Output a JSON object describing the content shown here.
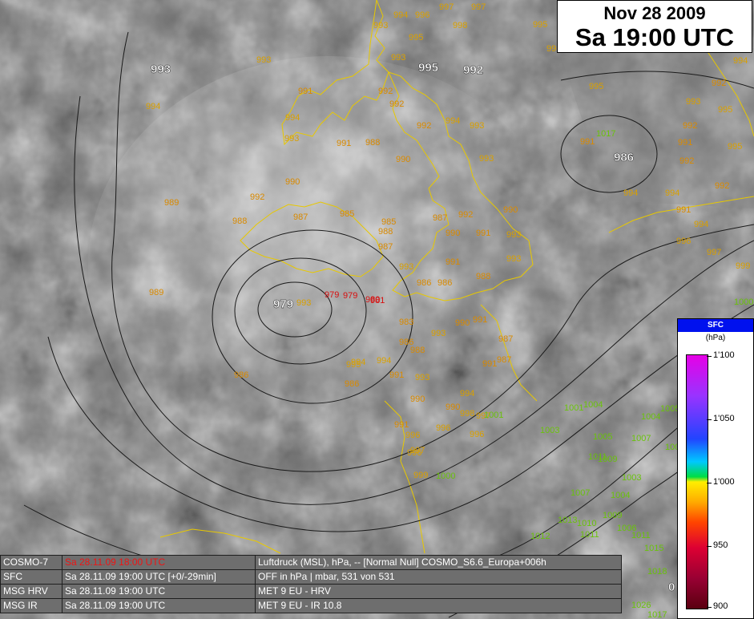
{
  "header": {
    "date": "Nov 28 2009",
    "time": "Sa 19:00 UTC"
  },
  "centers": [
    {
      "label": "993"
    },
    {
      "label": "995"
    },
    {
      "label": "992"
    },
    {
      "label": "986"
    },
    {
      "label": "979"
    },
    {
      "label": "0"
    }
  ],
  "observations": [
    "994",
    "996",
    "997",
    "997",
    "995",
    "998",
    "993",
    "993",
    "993",
    "994",
    "995",
    "993",
    "995",
    "993",
    "992",
    "991",
    "992",
    "994",
    "992",
    "991",
    "994",
    "993",
    "992",
    "992",
    "994",
    "993",
    "993",
    "991",
    "988",
    "990",
    "990",
    "992",
    "989",
    "988",
    "987",
    "985",
    "985",
    "988",
    "987",
    "987",
    "990",
    "991",
    "992",
    "990",
    "993",
    "993",
    "993",
    "986",
    "986",
    "988",
    "991",
    "993",
    "979",
    "979",
    "980",
    "981",
    "983",
    "986",
    "988",
    "993",
    "990",
    "991",
    "994",
    "995",
    "994",
    "991",
    "993",
    "991",
    "987",
    "987",
    "986",
    "986",
    "989",
    "990",
    "990",
    "991",
    "994",
    "996",
    "997",
    "996",
    "998",
    "996",
    "997",
    "996",
    "999",
    "1000",
    "1001",
    "1003",
    "1001",
    "1004",
    "1005",
    "1007",
    "1004",
    "1005",
    "1006",
    "1008",
    "1009",
    "1011",
    "1003",
    "1004",
    "1006",
    "1007",
    "1009",
    "1011",
    "1012",
    "1013",
    "1010",
    "1011",
    "1015",
    "1018",
    "1026",
    "1017",
    "1017",
    "994",
    "995",
    "995",
    "992",
    "991",
    "994",
    "992",
    "991",
    "994",
    "996",
    "997",
    "999",
    "1000",
    "1001",
    "998",
    "997",
    "995"
  ],
  "legend": {
    "title": "SFC",
    "unit": "(hPa)",
    "labels": [
      "1'100",
      "1'050",
      "1'000",
      "950",
      "900"
    ]
  },
  "info": [
    {
      "name": "COSMO-7",
      "time": "Sa 28.11.09 18:00 UTC",
      "desc": "Luftdruck (MSL), hPa, -- [Normal Null] COSMO_S6.6_Europa+006h"
    },
    {
      "name": "SFC",
      "time": "Sa 28.11.09 19:00 UTC [+0/-29min]",
      "desc": "OFF in hPa | mbar, 531 von 531"
    },
    {
      "name": "MSG HRV",
      "time": "Sa 28.11.09 19:00 UTC",
      "desc": "MET 9 EU - HRV"
    },
    {
      "name": "MSG IR",
      "time": "Sa 28.11.09 19:00 UTC",
      "desc": "MET 9 EU - IR 10.8"
    }
  ]
}
